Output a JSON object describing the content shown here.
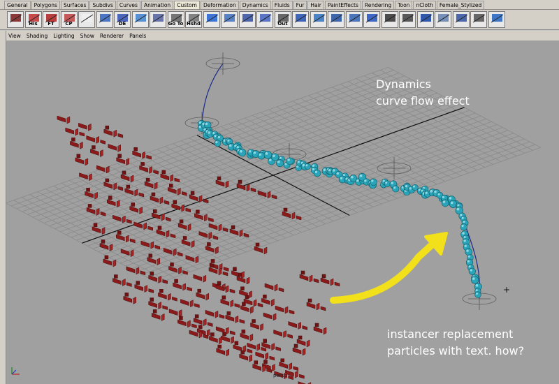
{
  "shelf": {
    "tabs": [
      "General",
      "Polygons",
      "Surfaces",
      "Subdivs",
      "Curves",
      "Animation",
      "Custom",
      "Deformation",
      "Dynamics",
      "Fluids",
      "Fur",
      "Hair",
      "PaintEffects",
      "Rendering",
      "Toon",
      "nCloth",
      "Female_Stylized"
    ],
    "active_tab": "Custom",
    "icons": [
      {
        "name": "graph-editor-icon",
        "label": ""
      },
      {
        "name": "history-icon",
        "label": "His"
      },
      {
        "name": "freeze-transform-icon",
        "label": "FT"
      },
      {
        "name": "center-pivot-icon",
        "label": "CP"
      },
      {
        "name": "blank-icon",
        "label": ""
      },
      {
        "name": "hypershade-icon",
        "label": ""
      },
      {
        "name": "delete-history-icon",
        "label": "DE"
      },
      {
        "name": "grid-snap-icon",
        "label": ""
      },
      {
        "name": "select-tool-icon",
        "label": ""
      },
      {
        "name": "mel-goto-icon",
        "label": "Go To"
      },
      {
        "name": "hypershade-mel-icon",
        "label": "Hshd"
      },
      {
        "name": "sculpt-icon",
        "label": ""
      },
      {
        "name": "paint-icon",
        "label": ""
      },
      {
        "name": "sphere-icon",
        "label": ""
      },
      {
        "name": "cursor-icon",
        "label": ""
      },
      {
        "name": "outliner-icon",
        "label": "Out"
      },
      {
        "name": "cube-icon",
        "label": ""
      },
      {
        "name": "plane-icon",
        "label": ""
      },
      {
        "name": "move-icon",
        "label": ""
      },
      {
        "name": "rotate-icon",
        "label": ""
      },
      {
        "name": "scale-icon",
        "label": ""
      },
      {
        "name": "key-icon",
        "label": ""
      },
      {
        "name": "render-icon",
        "label": ""
      },
      {
        "name": "ipr-icon",
        "label": ""
      },
      {
        "name": "lattice-icon",
        "label": ""
      },
      {
        "name": "bend-icon",
        "label": ""
      },
      {
        "name": "mel-script-icon",
        "label": ""
      },
      {
        "name": "wave-icon",
        "label": ""
      }
    ]
  },
  "panel_menu": [
    "View",
    "Shading",
    "Lighting",
    "Show",
    "Renderer",
    "Panels"
  ],
  "annotations": {
    "dynamics_line1": "Dynamics",
    "dynamics_line2": "curve flow effect",
    "instancer_line1": "instancer replacement",
    "instancer_line2": "particles with text. how?"
  },
  "camera_label": "persp",
  "colors": {
    "viewport_bg": "#a0a0a0",
    "grid": "#8a8a8a",
    "particles": "#2aa4b8",
    "instances": "#8b1a1a",
    "arrow": "#f2e01a",
    "annotation_text": "#ffffff"
  }
}
